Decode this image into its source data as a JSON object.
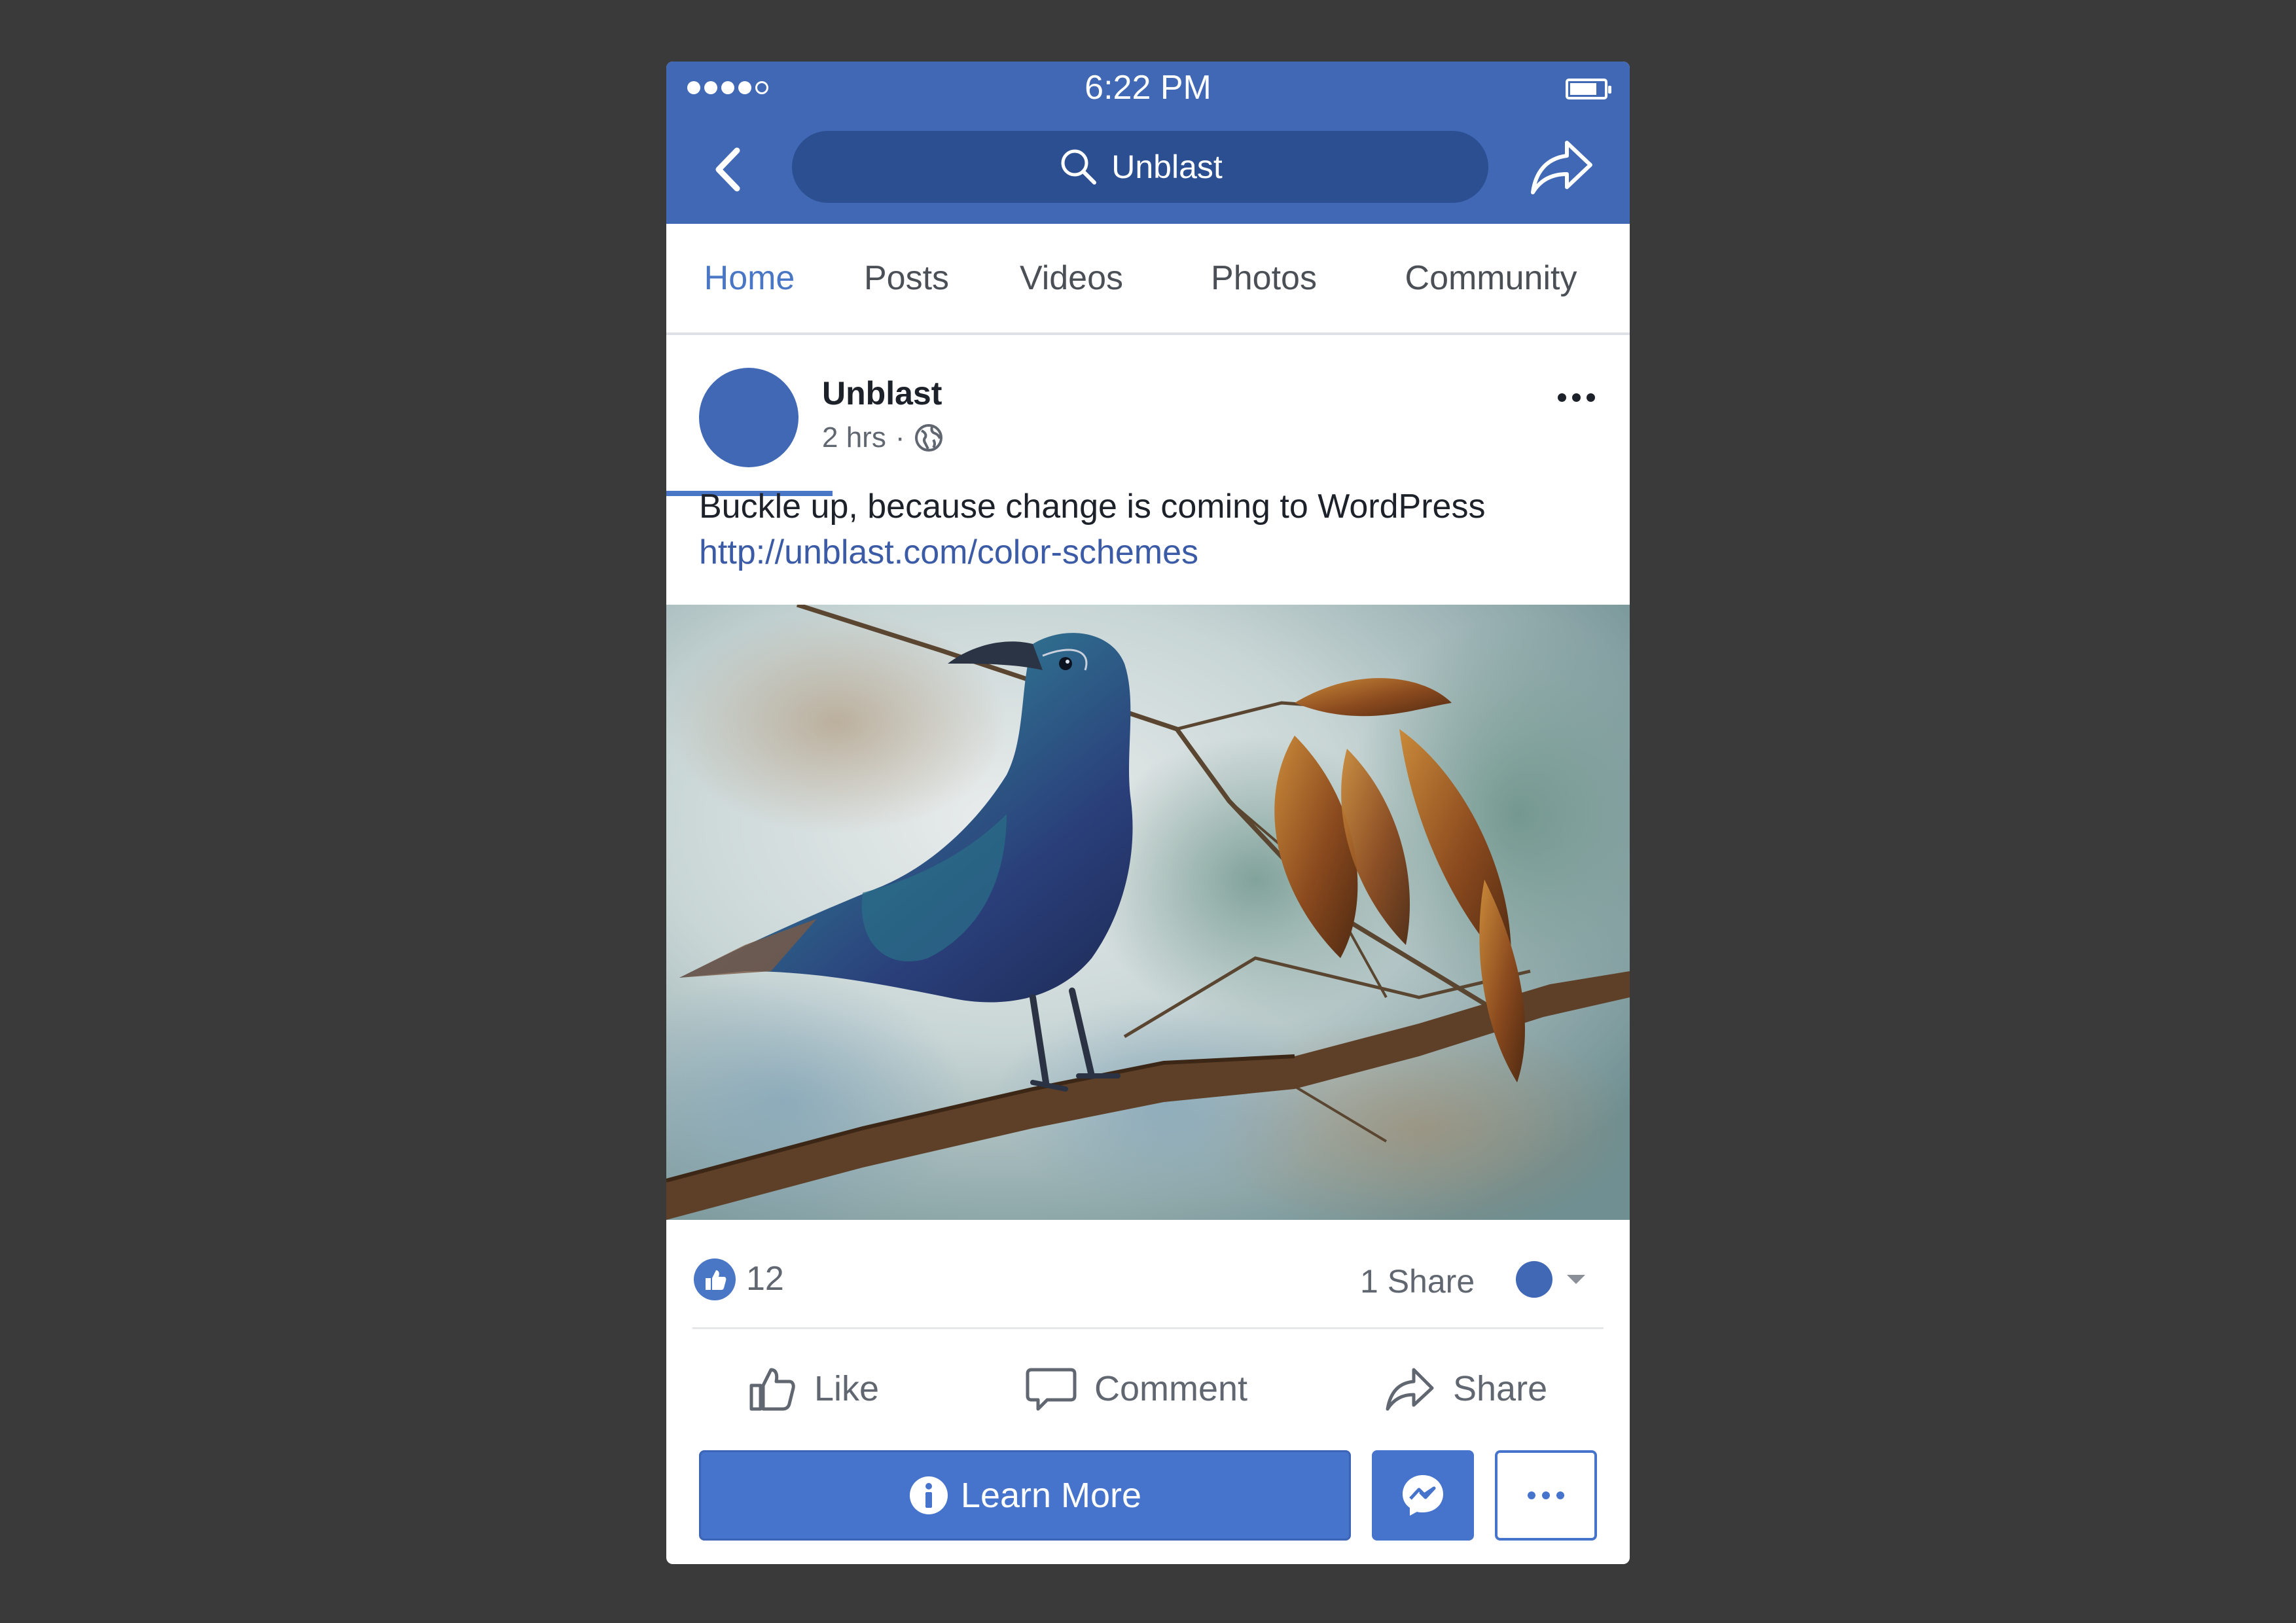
{
  "status_bar": {
    "time": "6:22 PM"
  },
  "search": {
    "query": "Unblast"
  },
  "tabs": [
    {
      "label": "Home",
      "active": true
    },
    {
      "label": "Posts"
    },
    {
      "label": "Videos"
    },
    {
      "label": "Photos"
    },
    {
      "label": "Community"
    }
  ],
  "post": {
    "author": "Unblast",
    "time": "2 hrs",
    "separator": "·",
    "text": "Buckle up, because change is coming to WordPress",
    "link": "http://unblast.com/color-schemes",
    "image_subject": "watercolor painting of a blue crow perched on a branch with brown leaves"
  },
  "reactions": {
    "like_count": "12",
    "share_count": "1 Share"
  },
  "actions": {
    "like": "Like",
    "comment": "Comment",
    "share": "Share"
  },
  "cta": {
    "learn_more": "Learn More"
  },
  "icons": {
    "back": "chevron-left-icon",
    "search": "search-icon",
    "share_header": "share-arrow-icon",
    "globe": "globe-icon",
    "like_badge": "thumbs-up-icon",
    "info": "info-icon",
    "messenger": "messenger-icon"
  },
  "colors": {
    "header": "#4168b5",
    "search_pill": "#2c4f92",
    "accent": "#4a76c6",
    "button": "#4673cc",
    "background": "#3a3a3a"
  }
}
